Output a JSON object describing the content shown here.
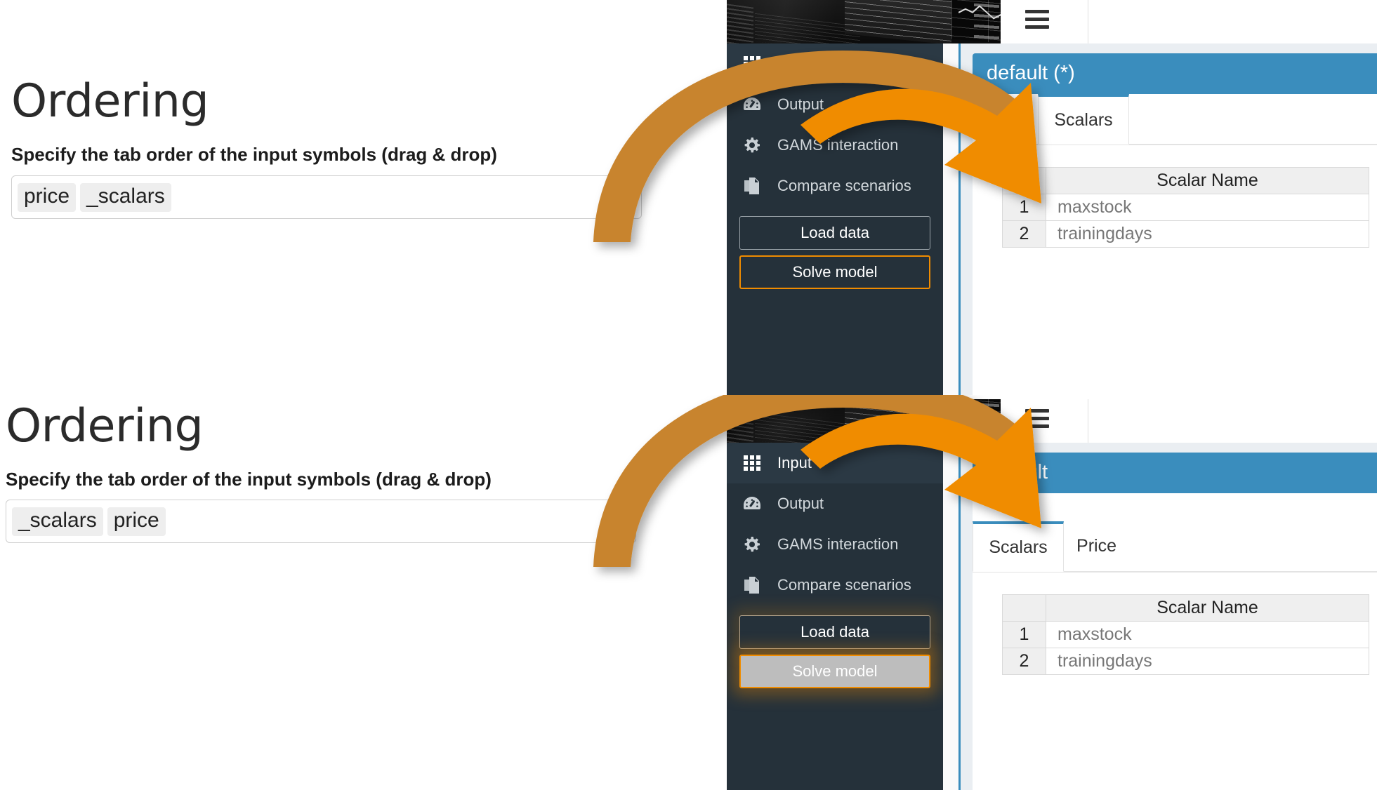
{
  "doc": {
    "title": "Ordering",
    "subtitle": "Specify the tab order of the input symbols (drag & drop)"
  },
  "panels": [
    {
      "id": "before",
      "chips": [
        "price",
        "_scalars"
      ],
      "scenario_label": "default (*)",
      "tabs": [
        {
          "label": "Price",
          "active": false
        },
        {
          "label": "Scalars",
          "active": true
        }
      ],
      "solve_state": "normal"
    },
    {
      "id": "after",
      "chips": [
        "_scalars",
        "price"
      ],
      "scenario_label": "default",
      "tabs": [
        {
          "label": "Scalars",
          "active": true
        },
        {
          "label": "Price",
          "active": false
        }
      ],
      "solve_state": "hover"
    }
  ],
  "sidebar": {
    "items": [
      {
        "label": "Input",
        "icon": "grid-icon",
        "active": true
      },
      {
        "label": "Output",
        "icon": "gauge-icon",
        "active": false
      },
      {
        "label": "GAMS interaction",
        "icon": "gear-icon",
        "active": false
      },
      {
        "label": "Compare scenarios",
        "icon": "copy-icon",
        "active": false
      }
    ],
    "buttons": {
      "load": "Load data",
      "solve": "Solve model"
    }
  },
  "table": {
    "index_header": "",
    "name_header": "Scalar Name",
    "rows": [
      {
        "index": "1",
        "name": "maxstock"
      },
      {
        "index": "2",
        "name": "trainingdays"
      }
    ]
  },
  "colors": {
    "accent_orange": "#f08c00",
    "arrow_tail": "#c8842e",
    "scenario_blue": "#3a8dbd",
    "sidebar_dark": "#25313a"
  }
}
